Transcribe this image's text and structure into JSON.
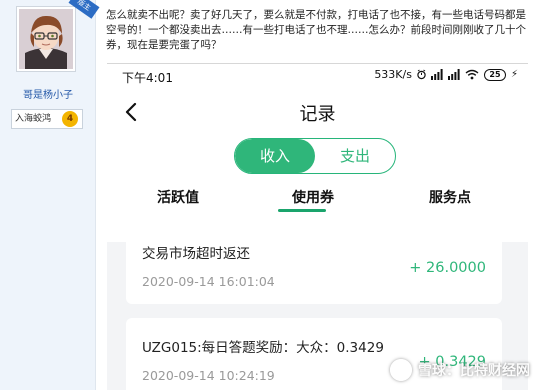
{
  "forum": {
    "badge_text": "版主",
    "username": "哥是杨小子",
    "rank_label": "入海蛟鸿",
    "rank_level": "4",
    "post_text": "怎么就卖不出呢？卖了好几天了，要么就是不付款，打电话了也不接，有一些电话号码都是空号的！一个都没卖出去……有一些打电话了也不理……怎么办？前段时间刚刚收了几十个券，现在是要完蛋了吗？"
  },
  "phone": {
    "status": {
      "time": "下午4:01",
      "speed": "533K/s",
      "battery": "25",
      "icons": [
        "alarm-icon",
        "signal-icon",
        "signal-icon",
        "wifi-icon",
        "battery-icon",
        "charging-icon"
      ]
    },
    "header": {
      "title": "记录",
      "back_icon": "chevron-left-icon"
    },
    "toggle": {
      "income": "收入",
      "expense": "支出",
      "selected": "收入"
    },
    "subtabs": [
      {
        "label": "活跃值"
      },
      {
        "label": "使用券",
        "selected": true
      },
      {
        "label": "服务点"
      }
    ],
    "records": [
      {
        "title": "交易市场超时返还",
        "time": "2020-09-14 16:01:04",
        "amount": "+ 26.0000"
      },
      {
        "title": "UZG015:每日答题奖励：大众：0.3429",
        "time": "2020-09-14 10:24:19",
        "amount": "+ 0.3429"
      }
    ],
    "accent_color": "#2fb67a"
  },
  "watermark": {
    "text": "雪球：比特财经网"
  }
}
